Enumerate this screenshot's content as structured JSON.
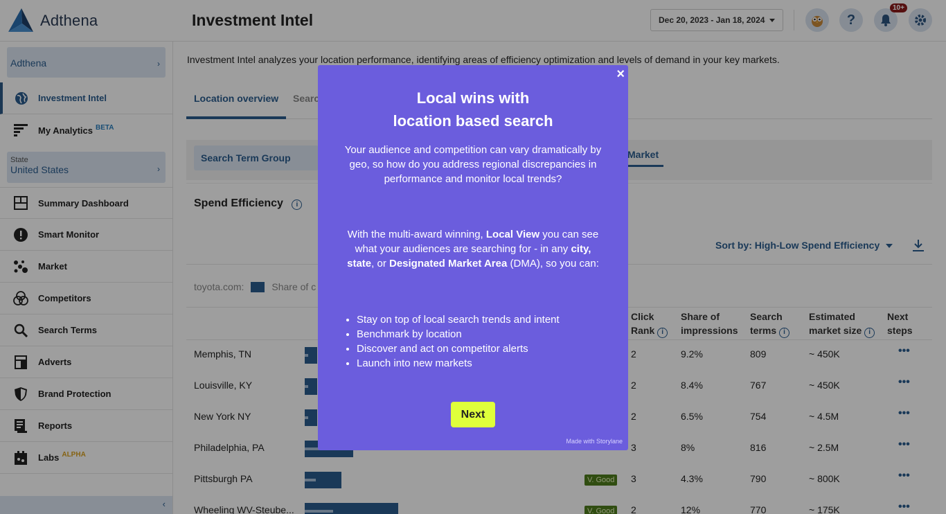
{
  "app": {
    "logo_text": "Adthena",
    "page_title": "Investment Intel",
    "date_range": "Dec 20, 2023 - Jan 18, 2024",
    "notification_badge": "10+",
    "help_icon": "?"
  },
  "sidebar": {
    "account_select": "Adthena",
    "state_label": "State",
    "state_value": "United States",
    "items": [
      {
        "label": "Investment Intel",
        "icon": "globe-icon"
      },
      {
        "label": "My Analytics",
        "icon": "analytics-icon",
        "tag": "BETA"
      },
      {
        "label": "Summary Dashboard",
        "icon": "dashboard-icon"
      },
      {
        "label": "Smart Monitor",
        "icon": "alert-icon"
      },
      {
        "label": "Market",
        "icon": "market-icon"
      },
      {
        "label": "Competitors",
        "icon": "competitors-icon"
      },
      {
        "label": "Search Terms",
        "icon": "search-icon"
      },
      {
        "label": "Adverts",
        "icon": "adverts-icon"
      },
      {
        "label": "Brand Protection",
        "icon": "shield-icon"
      },
      {
        "label": "Reports",
        "icon": "reports-icon"
      },
      {
        "label": "Labs",
        "icon": "labs-icon",
        "tag": "ALPHA"
      }
    ],
    "tag_colors": {
      "beta": "#2a7fbf",
      "alpha": "#d8a020"
    }
  },
  "main": {
    "description": "Investment Intel analyzes your location performance, identifying areas of efficiency optimization and levels of demand in your key markets.",
    "tabs": [
      {
        "label": "Location overview"
      },
      {
        "label": "Searc"
      }
    ],
    "filter_button": "Search Term Group",
    "market_tab": "Market",
    "section_title": "Spend Efficiency",
    "sort_label": "Sort by: High-Low Spend Efficiency",
    "legend_domain": "toyota.com:",
    "legend_series": "Share of c",
    "columns": {
      "click_rank": "Click Rank",
      "share_impressions": "Share of impressions",
      "search_terms": "Search terms",
      "market_size": "Estimated market size",
      "next_steps": "Next steps"
    },
    "rows": [
      {
        "location": "Memphis, TN",
        "bar": 0.13,
        "rating": "",
        "click_rank": "2",
        "share": "9.2%",
        "terms": "809",
        "size": "~ 450K"
      },
      {
        "location": "Louisville, KY",
        "bar": 0.13,
        "rating": "",
        "click_rank": "2",
        "share": "8.4%",
        "terms": "767",
        "size": "~ 450K"
      },
      {
        "location": "New York NY",
        "bar": 0.13,
        "rating": "",
        "click_rank": "2",
        "share": "6.5%",
        "terms": "754",
        "size": "~ 4.5M"
      },
      {
        "location": "Philadelphia, PA",
        "bar": 0.52,
        "rating": "",
        "click_rank": "3",
        "share": "8%",
        "terms": "816",
        "size": "~ 2.5M"
      },
      {
        "location": "Pittsburgh PA",
        "bar": 0.39,
        "rating": "V. Good",
        "click_rank": "3",
        "share": "4.3%",
        "terms": "790",
        "size": "~ 800K"
      },
      {
        "location": "Wheeling WV-Steube...",
        "bar": 1.0,
        "rating": "V. Good",
        "click_rank": "2",
        "share": "12%",
        "terms": "770",
        "size": "~ 175K"
      }
    ],
    "row_action": "•••"
  },
  "modal": {
    "title_line1": "Local wins with",
    "title_line2": "location based search",
    "paragraph1": "Your audience and competition can vary dramatically by geo, so how do you address regional discrepancies in performance and monitor local trends?",
    "p2_a": "With the multi-award winning, ",
    "p2_b": "Local View",
    "p2_c": " you can see what your audiences are searching for - in any ",
    "p2_d": "city, state",
    "p2_e": ", or ",
    "p2_f": "Designated Market Area",
    "p2_g": " (DMA), so you can:",
    "bullets": [
      "Stay on top of local search trends and intent",
      "Benchmark by location",
      "Discover and act on competitor alerts",
      "Launch into new markets"
    ],
    "next_label": "Next",
    "close_label": "×",
    "made_with": "Made with  Storylane",
    "bg_color": "#6b5ddd",
    "button_color": "#dfff3b"
  }
}
